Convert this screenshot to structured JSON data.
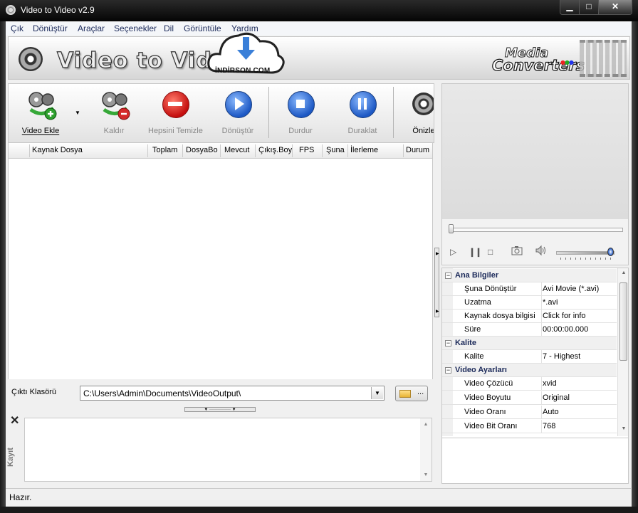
{
  "window": {
    "title": "Video to Video v2.9",
    "min": "▁",
    "max": "□",
    "close": "✕"
  },
  "menu": [
    "Çık",
    "Dönüştür",
    "Araçlar",
    "Seçenekler",
    "Dil",
    "Görüntüle",
    "Yardım"
  ],
  "banner": {
    "app_name": "Video to Video",
    "watermark": "İNDİRSON.COM",
    "brand_line1": "Media",
    "brand_line2": "Converters"
  },
  "toolbar": {
    "add_video": "Video Ekle",
    "remove": "Kaldır",
    "clear_all": "Hepsini Temizle",
    "convert": "Dönüştür",
    "stop": "Durdur",
    "pause": "Duraklat",
    "preview": "Önizle"
  },
  "columns": [
    "Kaynak Dosya",
    "Toplam",
    "DosyaBo",
    "Mevcut",
    "Çıkış.Boy",
    "FPS",
    "Şuna",
    "İlerleme",
    "Durum"
  ],
  "output": {
    "label": "Çıktı Klasörü",
    "path": "C:\\Users\\Admin\\Documents\\VideoOutput\\",
    "browse_dots": "..."
  },
  "log": {
    "close": "✕",
    "label": "Kayıt"
  },
  "properties": {
    "basic": {
      "title": "Ana Bilgiler",
      "convert_to_k": "Şuna Dönüştür",
      "convert_to_v": "Avi Movie (*.avi)",
      "ext_k": "Uzatma",
      "ext_v": "*.avi",
      "source_k": "Kaynak dosya bilgisi",
      "source_v": "Click for info",
      "duration_k": "Süre",
      "duration_v": "00:00:00.000"
    },
    "quality": {
      "title": "Kalite",
      "quality_k": "Kalite",
      "quality_v": "7 - Highest"
    },
    "video": {
      "title": "Video Ayarları",
      "codec_k": "Video Çözücü",
      "codec_v": "xvid",
      "size_k": "Video Boyutu",
      "size_v": "Original",
      "ratio_k": "Video Oranı",
      "ratio_v": "Auto",
      "bitrate_k": "Video Bit Oranı",
      "bitrate_v": "768"
    }
  },
  "status": {
    "text": "Hazır."
  },
  "colors": {
    "accent_red": "#c40e0e",
    "accent_blue": "#1d58c4",
    "category_text": "#1c2a5a"
  }
}
